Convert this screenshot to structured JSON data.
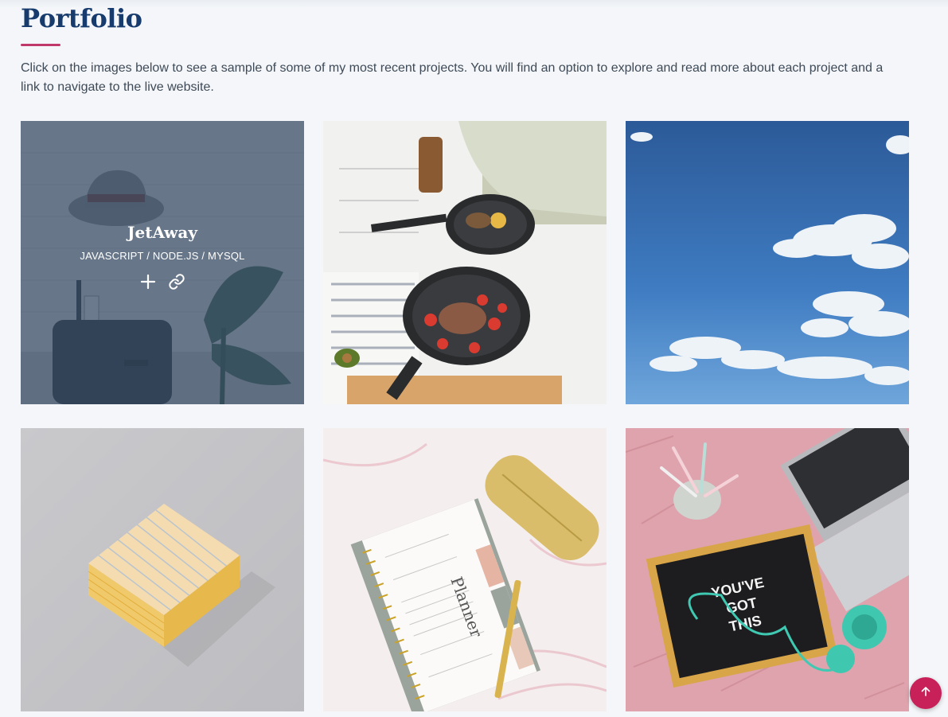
{
  "section": {
    "title": "Portfolio",
    "intro": "Click on the images below to see a sample of some of my most recent projects. You will find an option to explore and read more about each project and a link to navigate to the live website."
  },
  "projects": [
    {
      "image": "hat-and-suitcase-photo",
      "title": "JetAway",
      "tech": "JAVASCRIPT / NODE.JS / MYSQL",
      "hovered": true
    },
    {
      "image": "cooking-pans-photo",
      "hovered": false
    },
    {
      "image": "blue-sky-clouds-photo",
      "hovered": false
    },
    {
      "image": "sticky-notes-block-photo",
      "hovered": false
    },
    {
      "image": "planner-and-pencil-case-photo",
      "planner_text": "Planner",
      "hovered": false
    },
    {
      "image": "letterboard-and-laptop-photo",
      "letterboard_text": [
        "YOU'VE",
        "GOT",
        "THIS"
      ],
      "hovered": false
    }
  ],
  "icons": {
    "details": "plus-icon",
    "live_link": "link-icon",
    "back_to_top": "arrow-up-icon"
  },
  "colors": {
    "title": "#173b6c",
    "accent": "#c0376a",
    "back_to_top": "#c8215a",
    "overlay": "#364b64"
  }
}
